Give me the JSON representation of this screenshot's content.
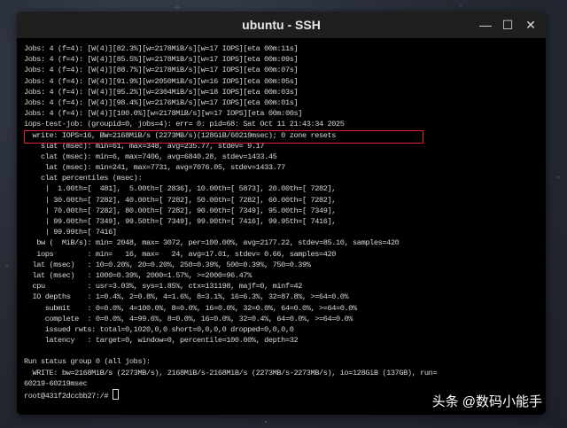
{
  "window": {
    "title": "ubuntu - SSH",
    "minimize": "—",
    "maximize": "☐",
    "close": "✕"
  },
  "lines": [
    "Jobs: 4 (f=4): [W(4)][82.3%][w=2178MiB/s][w=17 IOPS][eta 00m:11s]",
    "Jobs: 4 (f=4): [W(4)][85.5%][w=2178MiB/s][w=17 IOPS][eta 00m:09s]",
    "Jobs: 4 (f=4): [W(4)][88.7%][w=2178MiB/s][w=17 IOPS][eta 00m:07s]",
    "Jobs: 4 (f=4): [W(4)][91.9%][w=2050MiB/s][w=16 IOPS][eta 00m:05s]",
    "Jobs: 4 (f=4): [W(4)][95.2%][w=2304MiB/s][w=18 IOPS][eta 00m:03s]",
    "Jobs: 4 (f=4): [W(4)][98.4%][w=2176MiB/s][w=17 IOPS][eta 00m:01s]",
    "Jobs: 4 (f=4): [W(4)][100.0%][w=2178MiB/s][w=17 IOPS][eta 00m:00s]",
    "iops-test-job: (groupid=0, jobs=4): err= 0: pid=68: Sat Oct 11 21:43:34 2025",
    "  write: IOPS=16, BW=2168MiB/s (2273MB/s)(128GiB/60219msec); 0 zone resets",
    "    slat (msec): min=61, max=348, avg=235.77, stdev= 9.17",
    "    clat (msec): min=6, max=7406, avg=6840.28, stdev=1433.45",
    "     lat (msec): min=241, max=7731, avg=7076.05, stdev=1433.77",
    "    clat percentiles (msec):",
    "     |  1.00th=[  481],  5.00th=[ 2836], 10.00th=[ 5873], 20.00th=[ 7282],",
    "     | 30.00th=[ 7282], 40.00th=[ 7282], 50.00th=[ 7282], 60.00th=[ 7282],",
    "     | 70.00th=[ 7282], 80.00th=[ 7282], 90.00th=[ 7349], 95.00th=[ 7349],",
    "     | 99.00th=[ 7349], 99.50th=[ 7349], 99.90th=[ 7416], 99.95th=[ 7416],",
    "     | 99.99th=[ 7416]",
    "   bw (  MiB/s): min= 2048, max= 3072, per=100.00%, avg=2177.22, stdev=85.10, samples=420",
    "   iops        : min=   16, max=   24, avg=17.01, stdev= 0.66, samples=420",
    "  lat (msec)   : 10=0.20%, 20=0.20%, 250=0.39%, 500=0.39%, 750=0.39%",
    "  lat (msec)   : 1000=0.39%, 2000=1.57%, >=2000=96.47%",
    "  cpu          : usr=3.03%, sys=1.85%, ctx=131198, majf=0, minf=42",
    "  IO depths    : 1=0.4%, 2=0.8%, 4=1.6%, 8=3.1%, 16=6.3%, 32=87.8%, >=64=0.0%",
    "     submit    : 0=0.0%, 4=100.0%, 8=0.0%, 16=0.0%, 32=0.0%, 64=0.0%, >=64=0.0%",
    "     complete  : 0=0.0%, 4=99.6%, 8=0.0%, 16=0.0%, 32=0.4%, 64=0.0%, >=64=0.0%",
    "     issued rwts: total=0,1020,0,0 short=0,0,0,0 dropped=0,0,0,0",
    "     latency   : target=0, window=0, percentile=100.00%, depth=32",
    "",
    "Run status group 0 (all jobs):",
    "  WRITE: bw=2168MiB/s (2273MB/s), 2168MiB/s-2168MiB/s (2273MB/s-2273MB/s), io=128GiB (137GB), run=",
    "60219-60219msec"
  ],
  "prompt": "root@431f2dccbb27:/# ",
  "watermark": "头条 @数码小能手"
}
